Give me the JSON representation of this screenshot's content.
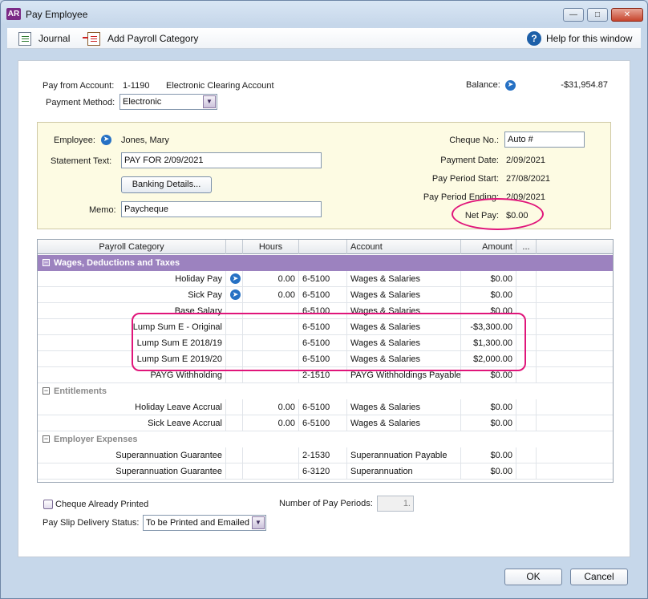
{
  "window": {
    "app_badge": "AR",
    "title": "Pay Employee"
  },
  "toolbar": {
    "journal": "Journal",
    "add_category": "Add Payroll Category",
    "help": "Help for this window"
  },
  "account": {
    "pay_from_label": "Pay from Account:",
    "account_number": "1-1190",
    "account_name": "Electronic Clearing Account",
    "balance_label": "Balance:",
    "balance_value": "-$31,954.87",
    "method_label": "Payment Method:",
    "method_value": "Electronic"
  },
  "employee": {
    "employee_label": "Employee:",
    "employee_name": "Jones, Mary",
    "statement_label": "Statement Text:",
    "statement_value": "PAY FOR 2/09/2021",
    "banking_button": "Banking Details...",
    "memo_label": "Memo:",
    "memo_value": "Paycheque",
    "cheque_label": "Cheque No.:",
    "cheque_value": "Auto #",
    "payment_date_label": "Payment Date:",
    "payment_date_value": "2/09/2021",
    "period_start_label": "Pay Period Start:",
    "period_start_value": "27/08/2021",
    "period_end_label": "Pay Period Ending:",
    "period_end_value": "2/09/2021",
    "net_pay_label": "Net Pay:",
    "net_pay_value": "$0.00"
  },
  "grid": {
    "headers": {
      "category": "Payroll Category",
      "hours": "Hours",
      "account": "Account",
      "amount": "Amount",
      "more": "..."
    },
    "sections": {
      "wages": "Wages, Deductions and Taxes",
      "entitlements": "Entitlements",
      "employer": "Employer Expenses"
    },
    "wages_rows": [
      {
        "category": "Holiday Pay",
        "hours": "0.00",
        "account_no": "6-5100",
        "account": "Wages & Salaries",
        "amount": "$0.00"
      },
      {
        "category": "Sick Pay",
        "hours": "0.00",
        "account_no": "6-5100",
        "account": "Wages & Salaries",
        "amount": "$0.00"
      },
      {
        "category": "Base Salary",
        "hours": "",
        "account_no": "6-5100",
        "account": "Wages & Salaries",
        "amount": "$0.00"
      },
      {
        "category": "Lump Sum E - Original",
        "hours": "",
        "account_no": "6-5100",
        "account": "Wages & Salaries",
        "amount": "-$3,300.00"
      },
      {
        "category": "Lump Sum E 2018/19",
        "hours": "",
        "account_no": "6-5100",
        "account": "Wages & Salaries",
        "amount": "$1,300.00"
      },
      {
        "category": "Lump Sum E 2019/20",
        "hours": "",
        "account_no": "6-5100",
        "account": "Wages & Salaries",
        "amount": "$2,000.00"
      },
      {
        "category": "PAYG Withholding",
        "hours": "",
        "account_no": "2-1510",
        "account": "PAYG Withholdings Payable",
        "amount": "$0.00"
      }
    ],
    "entitlement_rows": [
      {
        "category": "Holiday Leave Accrual",
        "hours": "0.00",
        "account_no": "6-5100",
        "account": "Wages & Salaries",
        "amount": "$0.00"
      },
      {
        "category": "Sick Leave Accrual",
        "hours": "0.00",
        "account_no": "6-5100",
        "account": "Wages & Salaries",
        "amount": "$0.00"
      }
    ],
    "employer_rows": [
      {
        "category": "Superannuation Guarantee",
        "hours": "",
        "account_no": "2-1530",
        "account": "Superannuation Payable",
        "amount": "$0.00"
      },
      {
        "category": "Superannuation Guarantee",
        "hours": "",
        "account_no": "6-3120",
        "account": "Superannuation",
        "amount": "$0.00"
      }
    ]
  },
  "footer": {
    "cheque_printed": "Cheque Already Printed",
    "periods_label": "Number of Pay Periods:",
    "periods_value": "1.",
    "delivery_label": "Pay Slip Delivery Status:",
    "delivery_value": "To be Printed and Emailed",
    "ok": "OK",
    "cancel": "Cancel"
  },
  "colors": {
    "section_active": "#9c82bf",
    "highlight_annotation": "#e0157a",
    "employee_panel": "#fdfbe3"
  }
}
